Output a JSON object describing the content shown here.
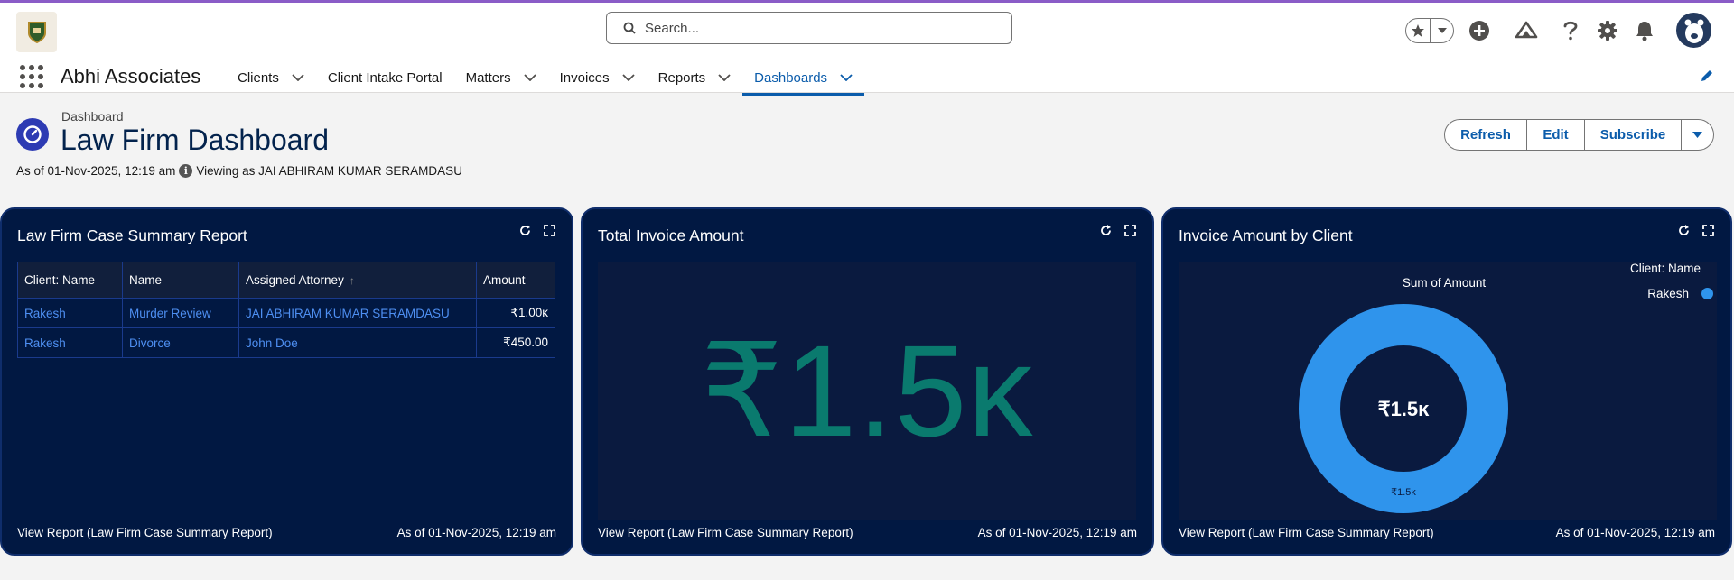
{
  "colors": {
    "accent": "#0b5cab",
    "card_bg": "#011842",
    "metric": "#0a7a6e",
    "donut": "#2f94ec"
  },
  "header": {
    "search_placeholder": "Search...",
    "app_name": "Abhi Associates"
  },
  "nav": {
    "items": [
      {
        "label": "Clients",
        "dropdown": true
      },
      {
        "label": "Client Intake Portal",
        "dropdown": false
      },
      {
        "label": "Matters",
        "dropdown": true
      },
      {
        "label": "Invoices",
        "dropdown": true
      },
      {
        "label": "Reports",
        "dropdown": true
      },
      {
        "label": "Dashboards",
        "dropdown": true,
        "active": true
      }
    ]
  },
  "page": {
    "breadcrumb": "Dashboard",
    "title": "Law Firm Dashboard",
    "as_of": "As of 01-Nov-2025, 12:19 am",
    "viewing_as": "Viewing as JAI ABHIRAM KUMAR SERAMDASU",
    "buttons": {
      "refresh": "Refresh",
      "edit": "Edit",
      "subscribe": "Subscribe"
    }
  },
  "cards": {
    "summary": {
      "title": "Law Firm Case Summary Report",
      "columns": [
        "Client: Name",
        "Name",
        "Assigned Attorney",
        "Amount"
      ],
      "rows": [
        {
          "client": "Rakesh",
          "name": "Murder Review",
          "attorney": "JAI ABHIRAM KUMAR SERAMDASU",
          "amount": "₹1.00ĸ"
        },
        {
          "client": "Rakesh",
          "name": "Divorce",
          "attorney": "John Doe",
          "amount": "₹450.00"
        }
      ],
      "footer_link": "View Report (Law Firm Case Summary Report)",
      "footer_asof": "As of 01-Nov-2025, 12:19 am"
    },
    "total": {
      "title": "Total Invoice Amount",
      "value": "₹1.5ĸ",
      "footer_link": "View Report (Law Firm Case Summary Report)",
      "footer_asof": "As of 01-Nov-2025, 12:19 am"
    },
    "by_client": {
      "title": "Invoice Amount by Client",
      "chart_label": "Sum of Amount",
      "center_value": "₹1.5ĸ",
      "slice_label": "₹1.5ĸ",
      "legend_title": "Client: Name",
      "footer_link": "View Report (Law Firm Case Summary Report)",
      "footer_asof": "As of 01-Nov-2025, 12:19 am"
    }
  },
  "chart_data": {
    "type": "pie",
    "title": "Sum of Amount",
    "categories": [
      "Rakesh"
    ],
    "values": [
      1450
    ],
    "legend": "top-right",
    "legend_title": "Client: Name",
    "center_label": "₹1.5ĸ"
  }
}
